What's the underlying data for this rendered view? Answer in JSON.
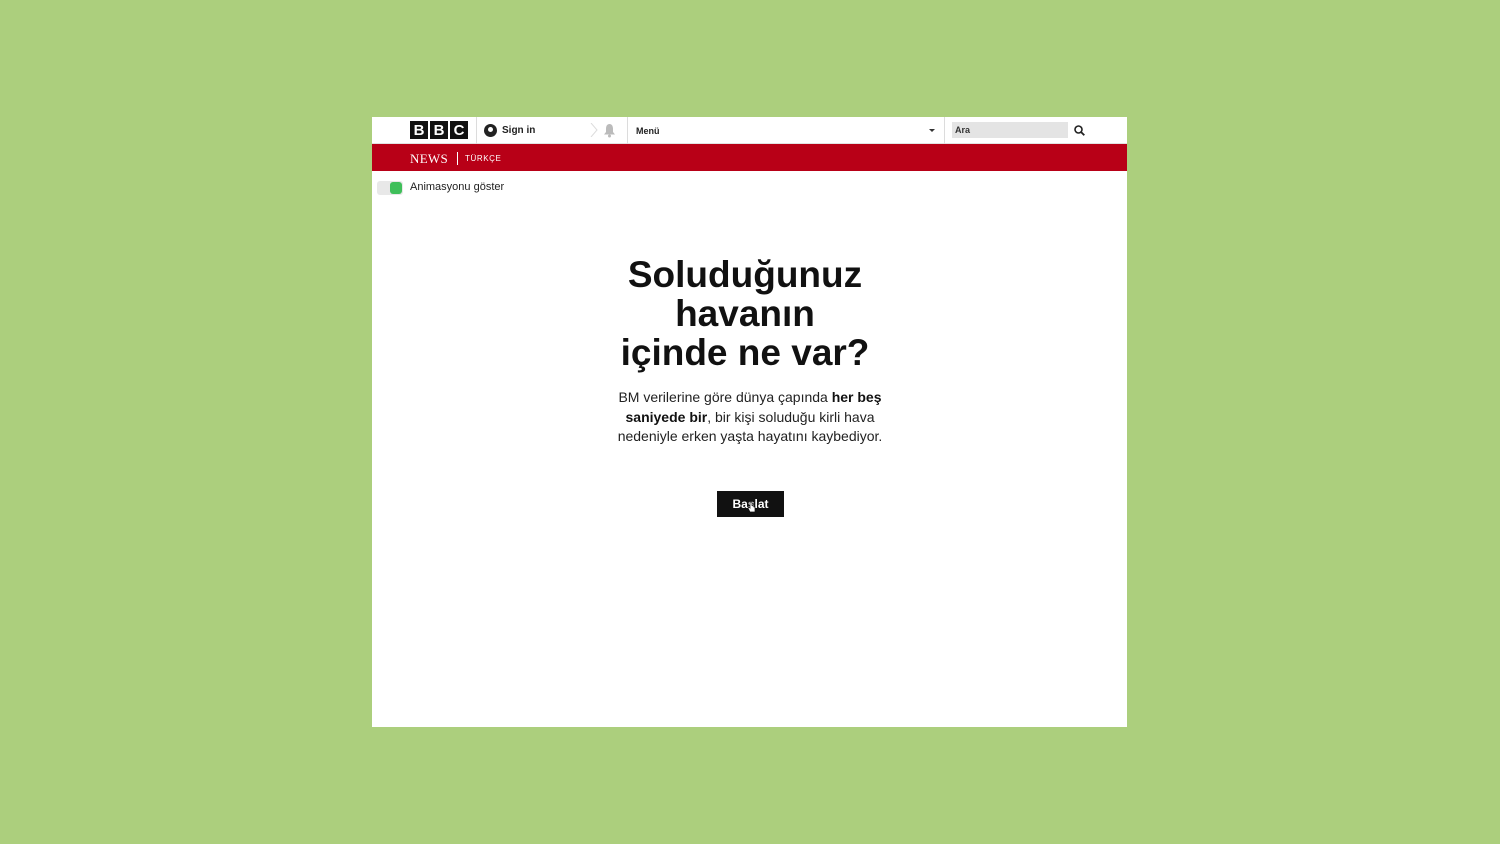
{
  "header": {
    "logo_letters": [
      "B",
      "B",
      "C"
    ],
    "signin_label": "Sign in",
    "menu_label": "Menü",
    "search_placeholder": "Ara"
  },
  "newsbar": {
    "news_label": "NEWS",
    "section_label": "TÜRKÇE",
    "color": "#b80017"
  },
  "toggle": {
    "label": "Animasyonu göster",
    "on": true,
    "on_color": "#3fbf5a"
  },
  "hero": {
    "title_lines": [
      "Soluduğunuz",
      "havanın",
      "içinde ne var?"
    ],
    "desc_part1": "BM verilerine göre dünya çapında ",
    "desc_bold": "her beş saniyede bir",
    "desc_part2": ", bir kişi soluduğu kirli hava nedeniyle erken yaşta hayatını kaybediyor.",
    "start_label": "Başlat"
  },
  "background_color": "#accf7d"
}
